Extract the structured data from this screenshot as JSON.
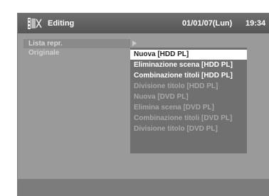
{
  "header": {
    "title": "Editing",
    "icon": "film-edit-icon",
    "date": "01/01/07(Lun)",
    "time": "19:34"
  },
  "left_menu": {
    "items": [
      {
        "label": "Lista repr.",
        "selected": true
      },
      {
        "label": "Originale",
        "selected": false
      }
    ]
  },
  "submenu": {
    "items": [
      {
        "label": "Nuova [HDD PL]",
        "state": "highlighted"
      },
      {
        "label": "Eliminazione scena [HDD PL]",
        "state": "enabled"
      },
      {
        "label": "Combinazione titoli [HDD PL]",
        "state": "enabled"
      },
      {
        "label": "Divisione titolo [HDD PL]",
        "state": "disabled"
      },
      {
        "label": "Nuova [DVD PL]",
        "state": "disabled"
      },
      {
        "label": "Elimina scena [DVD PL]",
        "state": "disabled"
      },
      {
        "label": "Combinazione titoli [DVD PL]",
        "state": "disabled"
      },
      {
        "label": "Divisione titolo [DVD PL]",
        "state": "disabled"
      }
    ]
  },
  "colors": {
    "background": "#9a9a9a",
    "header": "#5e5e5e",
    "submenu": "#707070",
    "highlight": "#ffffff"
  }
}
